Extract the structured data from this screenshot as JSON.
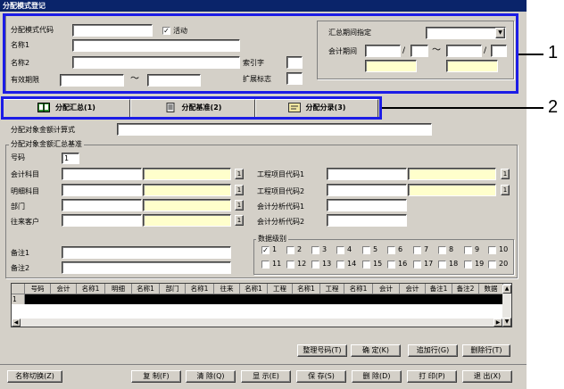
{
  "window": {
    "title": "分配模式登记"
  },
  "header": {
    "mode_code_label": "分配模式代码",
    "active_label": "活动",
    "active_checked": true,
    "name1_label": "名称1",
    "name2_label": "名称2",
    "valid_period_label": "有效期限",
    "tilde": "～",
    "index_label": "索引字",
    "ext_flag_label": "扩展标志",
    "summary_group_title": "汇总期间指定",
    "account_period_label": "会计期间",
    "slash": "/"
  },
  "tabs": [
    {
      "label": "分配汇总(1)",
      "icon": "book-icon"
    },
    {
      "label": "分配基准(2)",
      "icon": "document-icon"
    },
    {
      "label": "分配分录(3)",
      "icon": "journal-icon"
    }
  ],
  "form": {
    "formula_label": "分配对象金额计算式",
    "group_title": "分配对象金额汇总基准",
    "number_label": "号码",
    "number_value": "1",
    "account_label": "会计科目",
    "detail_label": "明细科目",
    "dept_label": "部门",
    "customer_label": "往来客户",
    "project1_label": "工程项目代码1",
    "project2_label": "工程项目代码2",
    "analysis1_label": "会计分析代码1",
    "analysis2_label": "会计分析代码2",
    "note1_label": "备注1",
    "note2_label": "备注2",
    "level_title": "数据级别",
    "lookup_btn": "1",
    "levels": [
      "1",
      "2",
      "3",
      "4",
      "5",
      "6",
      "7",
      "8",
      "9",
      "10",
      "11",
      "12",
      "13",
      "14",
      "15",
      "16",
      "17",
      "18",
      "19",
      "20"
    ]
  },
  "grid": {
    "columns": [
      "号码",
      "会计",
      "名称1",
      "明细",
      "名称1",
      "部门",
      "名称1",
      "往来",
      "名称1",
      "工程",
      "名称1",
      "工程",
      "名称1",
      "会计",
      "会计",
      "备注1",
      "备注2",
      "数据"
    ],
    "rows": [
      {
        "num": "1"
      }
    ]
  },
  "grid_buttons": {
    "renumber": "整理号码(T)",
    "confirm": "确 定(K)",
    "add_row": "追加行(G)",
    "delete_row": "删除行(T)"
  },
  "bottom_buttons": {
    "switch_name": "名称切换(Z)",
    "copy": "复 制(F)",
    "clear": "清 除(Q)",
    "display": "显 示(E)",
    "save": "保 存(S)",
    "delete": "删 除(D)",
    "print": "打 印(P)",
    "exit": "退 出(X)"
  },
  "annotations": {
    "one": "1",
    "two": "2"
  }
}
